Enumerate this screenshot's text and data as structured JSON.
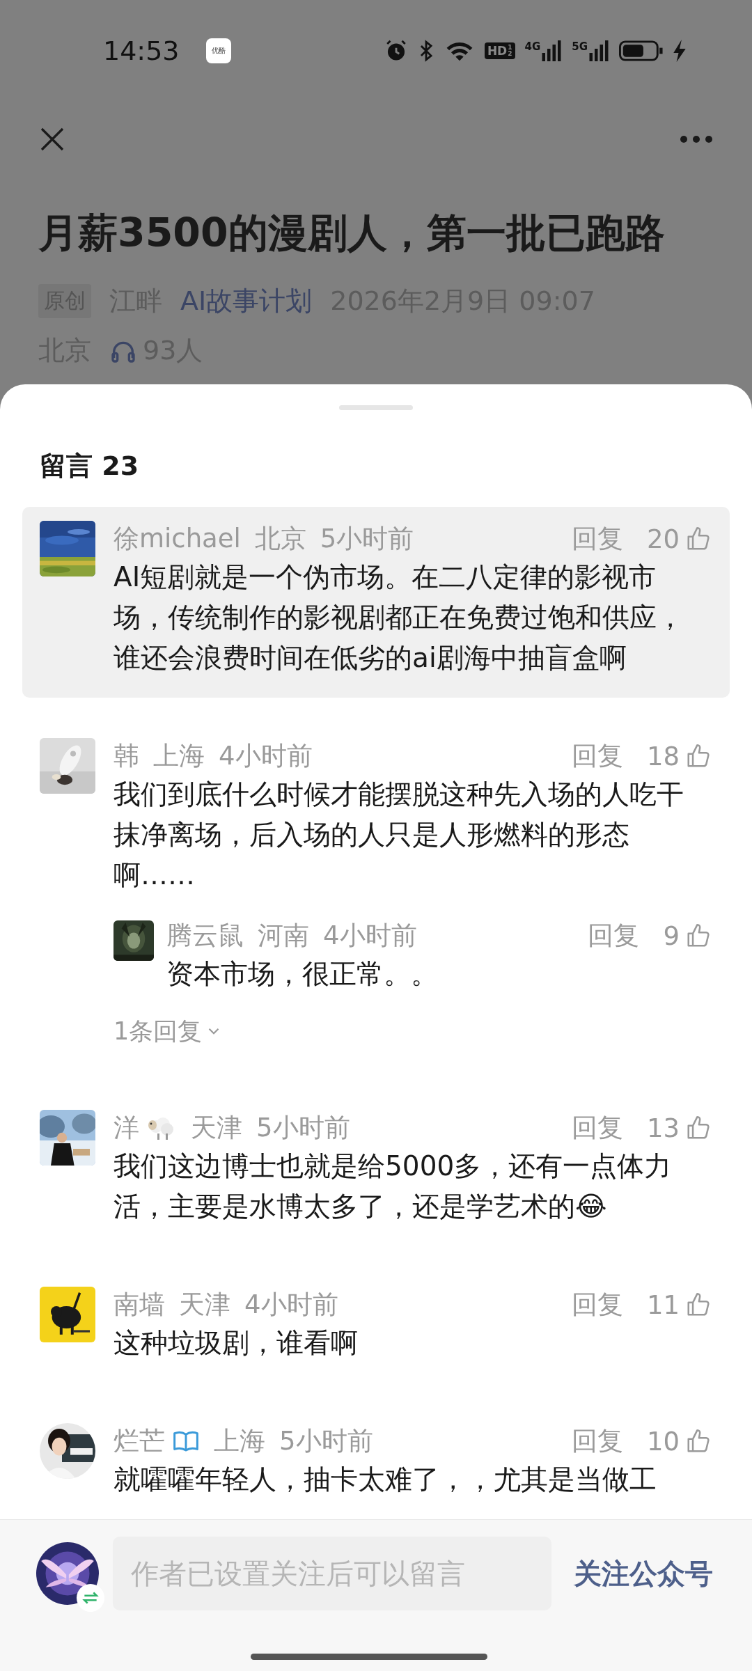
{
  "status_bar": {
    "time": "14:53",
    "app_badge": "优酷",
    "hd_badge": "HD",
    "hd_sub": [
      "1",
      "2"
    ],
    "networks": [
      "4G",
      "5G"
    ]
  },
  "article": {
    "title": "月薪3500的漫剧人，第一批已跑路",
    "tag": "原创",
    "author": "江畔",
    "account": "AI故事计划",
    "date": "2026年2月9日 09:07",
    "location": "北京",
    "listeners": "93人"
  },
  "comments": {
    "title": "留言 23",
    "items": [
      {
        "kind": "plain",
        "name": "徐michael",
        "location": "北京",
        "time": "5小时前",
        "reply_label": "回复",
        "likes": "20",
        "highlighted": true,
        "body": "AI短剧就是一个伪市场。在二八定律的影视市场，传统制作的影视剧都正在免费过饱和供应，谁还会浪费时间在低劣的ai剧海中抽盲盒啊"
      },
      {
        "kind": "plain",
        "name": "韩",
        "location": "上海",
        "time": "4小时前",
        "reply_label": "回复",
        "likes": "18",
        "highlighted": false,
        "body": "我们到底什么时候才能摆脱这种先入场的人吃干抹净离场，后入场的人只是人形燃料的形态啊……",
        "replies": [
          {
            "name": "腾云鼠",
            "location": "河南",
            "time": "4小时前",
            "reply_label": "回复",
            "likes": "9",
            "body": "资本市场，很正常。。"
          }
        ],
        "more_replies": "1条回复"
      },
      {
        "kind": "emoji",
        "name": "洋",
        "location": "天津",
        "time": "5小时前",
        "reply_label": "回复",
        "likes": "13",
        "highlighted": false,
        "body": "我们这边博士也就是给5000多，还有一点体力活，主要是水博太多了，还是学艺术的😂"
      },
      {
        "kind": "plain",
        "name": "南墙",
        "location": "天津",
        "time": "4小时前",
        "reply_label": "回复",
        "likes": "11",
        "highlighted": false,
        "body": "这种垃圾剧，谁看啊"
      },
      {
        "kind": "reader",
        "name": "烂芒",
        "location": "上海",
        "time": "5小时前",
        "reply_label": "回复",
        "likes": "10",
        "highlighted": false,
        "body": "就嚯嚯年轻人，抽卡太难了，，尤其是当做工"
      }
    ]
  },
  "composer": {
    "placeholder": "作者已设置关注后可以留言",
    "follow": "关注公众号"
  }
}
